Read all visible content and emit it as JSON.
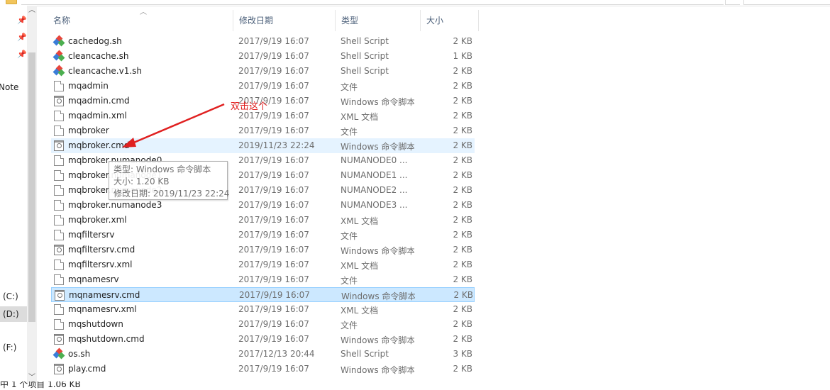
{
  "list": {
    "columns": {
      "name": "名称",
      "date": "修改日期",
      "type": "类型",
      "size": "大小"
    },
    "rows": [
      {
        "name": "cachedog.sh",
        "date": "2017/9/19 16:07",
        "type": "Shell Script",
        "size": "2 KB",
        "icon": "git-shell-icon"
      },
      {
        "name": "cleancache.sh",
        "date": "2017/9/19 16:07",
        "type": "Shell Script",
        "size": "1 KB",
        "icon": "git-shell-icon"
      },
      {
        "name": "cleancache.v1.sh",
        "date": "2017/9/19 16:07",
        "type": "Shell Script",
        "size": "2 KB",
        "icon": "git-shell-icon"
      },
      {
        "name": "mqadmin",
        "date": "2017/9/19 16:07",
        "type": "文件",
        "size": "2 KB",
        "icon": "file-icon"
      },
      {
        "name": "mqadmin.cmd",
        "date": "2017/9/19 16:07",
        "type": "Windows 命令脚本",
        "size": "2 KB",
        "icon": "cmd-script-icon"
      },
      {
        "name": "mqadmin.xml",
        "date": "2017/9/19 16:07",
        "type": "XML 文档",
        "size": "2 KB",
        "icon": "file-icon"
      },
      {
        "name": "mqbroker",
        "date": "2017/9/19 16:07",
        "type": "文件",
        "size": "2 KB",
        "icon": "file-icon"
      },
      {
        "name": "mqbroker.cmd",
        "date": "2019/11/23 22:24",
        "type": "Windows 命令脚本",
        "size": "2 KB",
        "icon": "cmd-script-icon",
        "state": "hover"
      },
      {
        "name": "mqbroker.numanode0",
        "date": "2017/9/19 16:07",
        "type": "NUMANODE0 ...",
        "size": "2 KB",
        "icon": "file-icon"
      },
      {
        "name": "mqbroker.numanode1",
        "date": "2017/9/19 16:07",
        "type": "NUMANODE1 ...",
        "size": "2 KB",
        "icon": "file-icon"
      },
      {
        "name": "mqbroker.numanode2",
        "date": "2017/9/19 16:07",
        "type": "NUMANODE2 ...",
        "size": "2 KB",
        "icon": "file-icon"
      },
      {
        "name": "mqbroker.numanode3",
        "date": "2017/9/19 16:07",
        "type": "NUMANODE3 ...",
        "size": "2 KB",
        "icon": "file-icon"
      },
      {
        "name": "mqbroker.xml",
        "date": "2017/9/19 16:07",
        "type": "XML 文档",
        "size": "2 KB",
        "icon": "file-icon"
      },
      {
        "name": "mqfiltersrv",
        "date": "2017/9/19 16:07",
        "type": "文件",
        "size": "2 KB",
        "icon": "file-icon"
      },
      {
        "name": "mqfiltersrv.cmd",
        "date": "2017/9/19 16:07",
        "type": "Windows 命令脚本",
        "size": "2 KB",
        "icon": "cmd-script-icon"
      },
      {
        "name": "mqfiltersrv.xml",
        "date": "2017/9/19 16:07",
        "type": "XML 文档",
        "size": "2 KB",
        "icon": "file-icon"
      },
      {
        "name": "mqnamesrv",
        "date": "2017/9/19 16:07",
        "type": "文件",
        "size": "2 KB",
        "icon": "file-icon"
      },
      {
        "name": "mqnamesrv.cmd",
        "date": "2017/9/19 16:07",
        "type": "Windows 命令脚本",
        "size": "2 KB",
        "icon": "cmd-script-icon",
        "state": "selected"
      },
      {
        "name": "mqnamesrv.xml",
        "date": "2017/9/19 16:07",
        "type": "XML 文档",
        "size": "2 KB",
        "icon": "file-icon"
      },
      {
        "name": "mqshutdown",
        "date": "2017/9/19 16:07",
        "type": "文件",
        "size": "2 KB",
        "icon": "file-icon"
      },
      {
        "name": "mqshutdown.cmd",
        "date": "2017/9/19 16:07",
        "type": "Windows 命令脚本",
        "size": "2 KB",
        "icon": "cmd-script-icon"
      },
      {
        "name": "os.sh",
        "date": "2017/12/13 20:44",
        "type": "Shell Script",
        "size": "3 KB",
        "icon": "git-shell-icon"
      },
      {
        "name": "play.cmd",
        "date": "2017/9/19 16:07",
        "type": "Windows 命令脚本",
        "size": "2 KB",
        "icon": "cmd-script-icon"
      }
    ]
  },
  "nav": {
    "items": [
      {
        "label": "Note"
      },
      {
        "label": "(C:)"
      },
      {
        "label": "(D:)",
        "selected": true
      },
      {
        "label": "(F:)"
      }
    ]
  },
  "tooltip": {
    "type_line": "类型: Windows 命令脚本",
    "size_line": "大小: 1.20 KB",
    "date_line": "修改日期: 2019/11/23 22:24"
  },
  "annotation": {
    "text": "双击这个",
    "color": "#e02020"
  },
  "status": {
    "text": "中 1 个项目  1.06 KB"
  },
  "colors": {
    "hover_row": "#e5f3ff",
    "selected_row": "#cce8ff",
    "selected_border": "#99d1ff",
    "header_text": "#4c607a"
  }
}
